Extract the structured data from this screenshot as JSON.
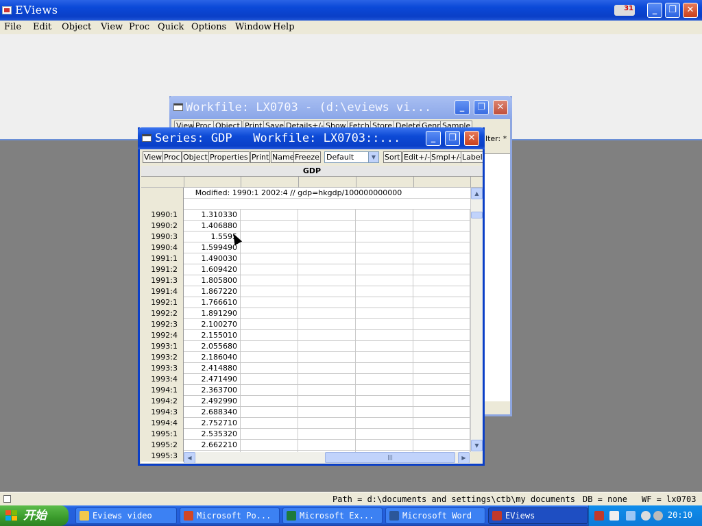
{
  "app": {
    "title": "EViews",
    "minimize_glyph": "_",
    "restore_glyph": "❐",
    "close_glyph": "✕",
    "badge": "31"
  },
  "menubar": [
    "File",
    "Edit",
    "Object",
    "View",
    "Proc",
    "Quick",
    "Options",
    "Window",
    "Help"
  ],
  "workfile_window": {
    "title": "Workfile: LX0703 - (d:\\eviews vi...",
    "toolbar": [
      "View",
      "Proc",
      "Object",
      "Print",
      "Save",
      "Details+/-",
      "Show",
      "Fetch",
      "Store",
      "Delete",
      "Genr",
      "Sample"
    ],
    "filter_label": "ilter: *"
  },
  "series_window": {
    "title": "Series: GDP   Workfile: LX0703::...",
    "toolbar": [
      "View",
      "Proc",
      "Object",
      "Properties",
      "Print",
      "Name",
      "Freeze",
      "Sort",
      "Edit+/-",
      "Smpl+/-",
      "Label+"
    ],
    "display_mode": "Default",
    "column_header": "GDP",
    "modified_note": "Modified: 1990:1 2002:4 // gdp=hkgdp/100000000000",
    "rows": [
      {
        "obs": "1990:1",
        "value": "1.310330"
      },
      {
        "obs": "1990:2",
        "value": "1.406880"
      },
      {
        "obs": "1990:3",
        "value": "1.5595"
      },
      {
        "obs": "1990:4",
        "value": "1.599490"
      },
      {
        "obs": "1991:1",
        "value": "1.490030"
      },
      {
        "obs": "1991:2",
        "value": "1.609420"
      },
      {
        "obs": "1991:3",
        "value": "1.805800"
      },
      {
        "obs": "1991:4",
        "value": "1.867220"
      },
      {
        "obs": "1992:1",
        "value": "1.766610"
      },
      {
        "obs": "1992:2",
        "value": "1.891290"
      },
      {
        "obs": "1992:3",
        "value": "2.100270"
      },
      {
        "obs": "1992:4",
        "value": "2.155010"
      },
      {
        "obs": "1993:1",
        "value": "2.055680"
      },
      {
        "obs": "1993:2",
        "value": "2.186040"
      },
      {
        "obs": "1993:3",
        "value": "2.414880"
      },
      {
        "obs": "1993:4",
        "value": "2.471490"
      },
      {
        "obs": "1994:1",
        "value": "2.363700"
      },
      {
        "obs": "1994:2",
        "value": "2.492990"
      },
      {
        "obs": "1994:3",
        "value": "2.688340"
      },
      {
        "obs": "1994:4",
        "value": "2.752710"
      },
      {
        "obs": "1995:1",
        "value": "2.535320"
      },
      {
        "obs": "1995:2",
        "value": "2.662210"
      },
      {
        "obs": "1995:3",
        "value": ""
      }
    ]
  },
  "statusbar": {
    "path": "Path = d:\\documents and settings\\ctb\\my documents",
    "db": "DB = none",
    "wf": "WF = lx0703"
  },
  "taskbar": {
    "start_label": "开始",
    "tasks": [
      {
        "label": "Eviews video",
        "icon": "folder-icon",
        "color": "#f2c94c"
      },
      {
        "label": "Microsoft Po...",
        "icon": "powerpoint-icon",
        "color": "#d24726"
      },
      {
        "label": "Microsoft Ex...",
        "icon": "excel-icon",
        "color": "#1d7a3a"
      },
      {
        "label": "Microsoft Word",
        "icon": "word-icon",
        "color": "#2b579a"
      },
      {
        "label": "EViews",
        "icon": "eviews-icon",
        "color": "#c0392b"
      }
    ],
    "clock": "20:10"
  }
}
